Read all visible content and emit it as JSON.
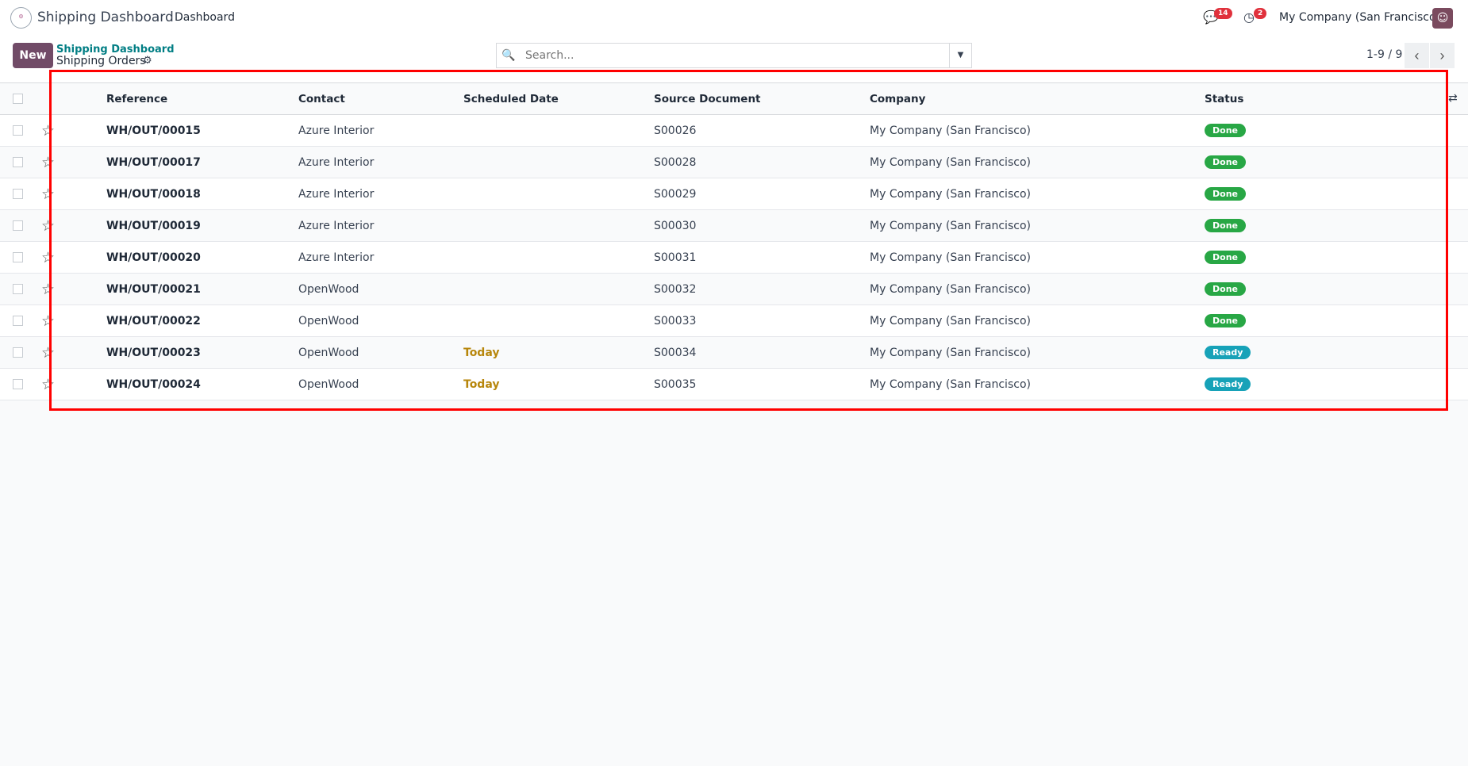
{
  "app": {
    "title": "Shipping Dashboard",
    "menu": "Dashboard",
    "messages_count": "14",
    "activities_count": "2",
    "company": "My Company (San Francisco)"
  },
  "control": {
    "new_label": "New",
    "breadcrumb_parent": "Shipping Dashboard",
    "breadcrumb_current": "Shipping Orders",
    "search_placeholder": "Search...",
    "pager": "1-9 / 9"
  },
  "columns": [
    "Reference",
    "Contact",
    "Scheduled Date",
    "Source Document",
    "Company",
    "Status"
  ],
  "rows": [
    {
      "ref": "WH/OUT/00015",
      "contact": "Azure Interior",
      "date": "",
      "source": "S00026",
      "company": "My Company (San Francisco)",
      "status": "Done"
    },
    {
      "ref": "WH/OUT/00017",
      "contact": "Azure Interior",
      "date": "",
      "source": "S00028",
      "company": "My Company (San Francisco)",
      "status": "Done"
    },
    {
      "ref": "WH/OUT/00018",
      "contact": "Azure Interior",
      "date": "",
      "source": "S00029",
      "company": "My Company (San Francisco)",
      "status": "Done"
    },
    {
      "ref": "WH/OUT/00019",
      "contact": "Azure Interior",
      "date": "",
      "source": "S00030",
      "company": "My Company (San Francisco)",
      "status": "Done"
    },
    {
      "ref": "WH/OUT/00020",
      "contact": "Azure Interior",
      "date": "",
      "source": "S00031",
      "company": "My Company (San Francisco)",
      "status": "Done"
    },
    {
      "ref": "WH/OUT/00021",
      "contact": "OpenWood",
      "date": "",
      "source": "S00032",
      "company": "My Company (San Francisco)",
      "status": "Done"
    },
    {
      "ref": "WH/OUT/00022",
      "contact": "OpenWood",
      "date": "",
      "source": "S00033",
      "company": "My Company (San Francisco)",
      "status": "Done"
    },
    {
      "ref": "WH/OUT/00023",
      "contact": "OpenWood",
      "date": "Today",
      "source": "S00034",
      "company": "My Company (San Francisco)",
      "status": "Ready"
    },
    {
      "ref": "WH/OUT/00024",
      "contact": "OpenWood",
      "date": "Today",
      "source": "S00035",
      "company": "My Company (San Francisco)",
      "status": "Ready"
    }
  ]
}
